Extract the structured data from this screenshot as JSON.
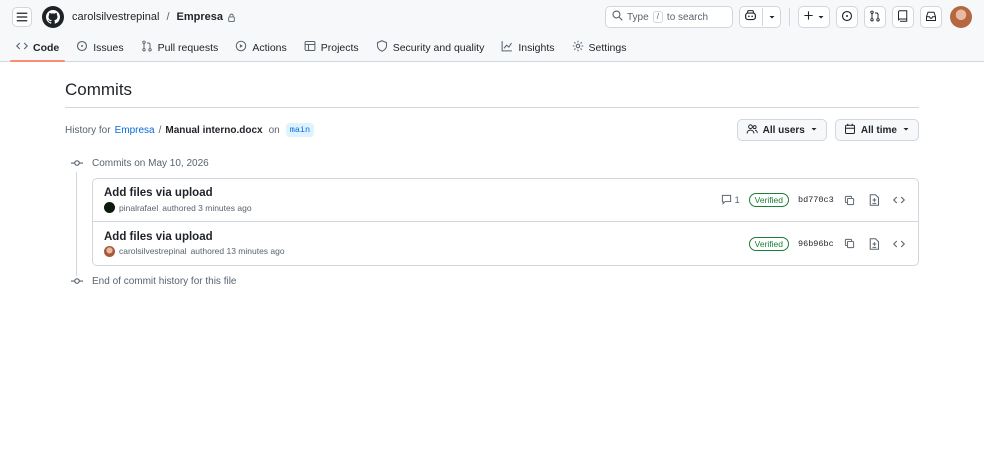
{
  "header": {
    "owner": "carolsilvestrepinal",
    "separator": "/",
    "repo": "Empresa",
    "search": {
      "prefix": "Type",
      "key": "/",
      "suffix": "to search"
    }
  },
  "tabs": [
    {
      "label": "Code",
      "icon": "code-icon"
    },
    {
      "label": "Issues",
      "icon": "issue-icon"
    },
    {
      "label": "Pull requests",
      "icon": "pull-request-icon"
    },
    {
      "label": "Actions",
      "icon": "play-icon"
    },
    {
      "label": "Projects",
      "icon": "table-icon"
    },
    {
      "label": "Security and quality",
      "icon": "shield-icon"
    },
    {
      "label": "Insights",
      "icon": "graph-icon"
    },
    {
      "label": "Settings",
      "icon": "gear-icon"
    }
  ],
  "page": {
    "title": "Commits",
    "history_prefix": "History for",
    "history_repo": "Empresa",
    "history_sep": "/",
    "history_file": "Manual interno.docx",
    "history_on": "on",
    "branch": "main",
    "filter_users": "All users",
    "filter_time": "All time"
  },
  "timeline": {
    "group_label": "Commits on May 10, 2026",
    "end_label": "End of commit history for this file",
    "commits": [
      {
        "message": "Add files via upload",
        "author": "pinalrafael",
        "authored": "authored 3 minutes ago",
        "comments": "1",
        "verified": "Verified",
        "sha": "bd770c3"
      },
      {
        "message": "Add files via upload",
        "author": "carolsilvestrepinal",
        "authored": "authored 13 minutes ago",
        "comments": "",
        "verified": "Verified",
        "sha": "96b96bc"
      }
    ]
  },
  "colors": {
    "link": "#0969da",
    "verified": "#1a7f37",
    "tab_underline": "#fd8c73"
  }
}
